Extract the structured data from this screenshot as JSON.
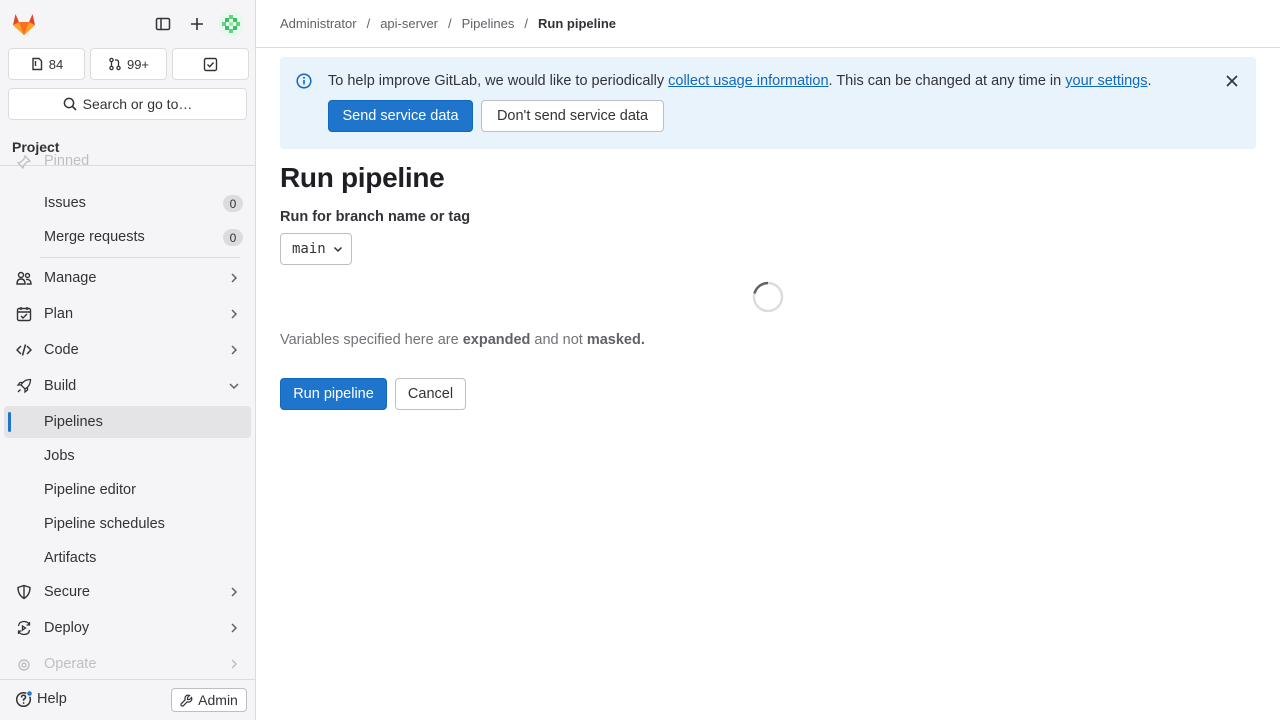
{
  "sidebar": {
    "counts": {
      "issues": "84",
      "merge_requests": "99+"
    },
    "search_label": "Search or go to…",
    "project_header": "Project",
    "pinned_label": "Pinned",
    "pinned_items": [
      {
        "label": "Issues",
        "badge": "0"
      },
      {
        "label": "Merge requests",
        "badge": "0"
      }
    ],
    "sections": {
      "manage": "Manage",
      "plan": "Plan",
      "code": "Code",
      "build": "Build",
      "secure": "Secure",
      "deploy": "Deploy",
      "operate": "Operate"
    },
    "build_items": [
      "Pipelines",
      "Jobs",
      "Pipeline editor",
      "Pipeline schedules",
      "Artifacts"
    ],
    "help_label": "Help",
    "admin_label": "Admin"
  },
  "breadcrumb": [
    "Administrator",
    "api-server",
    "Pipelines",
    "Run pipeline"
  ],
  "alert": {
    "text_before": "To help improve GitLab, we would like to periodically ",
    "link1": "collect usage information",
    "text_middle": ". This can be changed at any time in ",
    "link2": "your settings",
    "text_after": ".",
    "send_label": "Send service data",
    "nosend_label": "Don't send service data"
  },
  "page": {
    "title": "Run pipeline",
    "branch_label": "Run for branch name or tag",
    "branch_value": "main",
    "vars_before": "Variables specified here are ",
    "vars_bold1": "expanded",
    "vars_middle": " and not ",
    "vars_bold2": "masked.",
    "run_label": "Run pipeline",
    "cancel_label": "Cancel"
  },
  "colors": {
    "accent": "#1f75cb",
    "alert_bg": "#e9f3fc",
    "sidebar_bg": "#f5f5f7"
  }
}
